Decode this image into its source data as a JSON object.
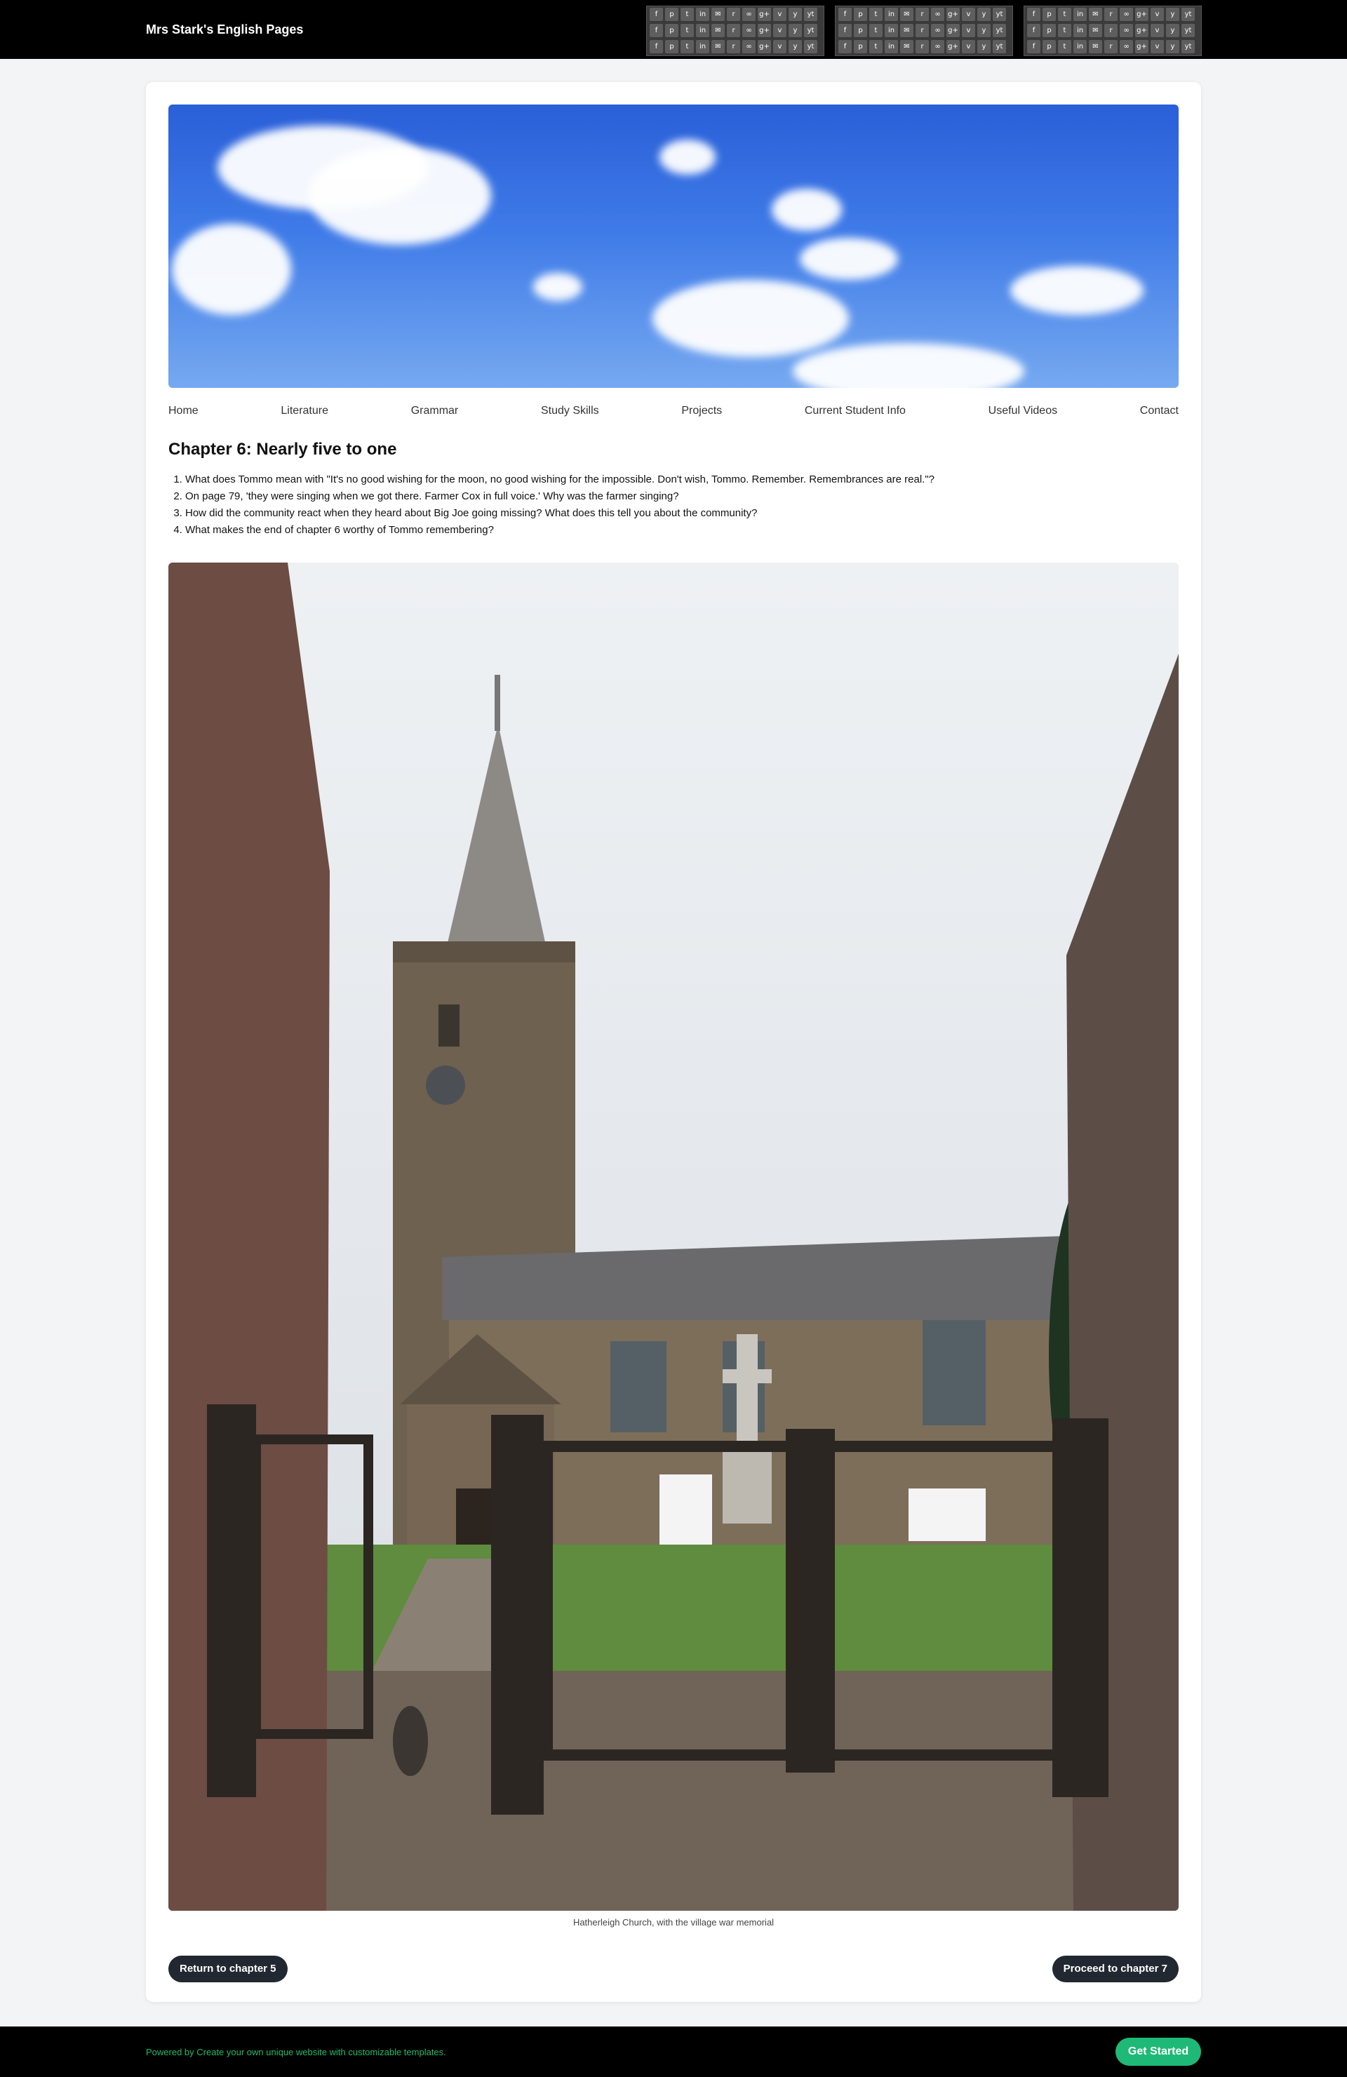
{
  "header": {
    "site_title": "Mrs Stark's English Pages",
    "social_icons": [
      "f",
      "p",
      "t",
      "in",
      "✉",
      "rss",
      "∞",
      "g+",
      "v",
      "y",
      "yt"
    ]
  },
  "nav": {
    "items": [
      "Home",
      "Literature",
      "Grammar",
      "Study Skills",
      "Projects",
      "Current Student Info",
      "Useful Videos",
      "Contact"
    ]
  },
  "main": {
    "title": "Chapter 6: Nearly five to one",
    "questions": [
      "What does Tommo mean with \"It's no good wishing for the moon, no good wishing for the impossible. Don't wish, Tommo. Remember. Remembrances are real.\"?",
      "On page 79, 'they were singing when we got there. Farmer Cox in full voice.' Why was the farmer singing?",
      "How did the community react when they heard about Big Joe going missing? What does this tell you about the community?",
      "What makes the end of chapter 6 worthy of Tommo remembering?"
    ],
    "photo_caption": "Hatherleigh Church, with the village war memorial",
    "prev_button": "Return to chapter 5",
    "next_button": "Proceed to chapter 7"
  },
  "footer": {
    "powered_text": "Powered by Create your own unique website with customizable templates.",
    "cta": "Get Started"
  }
}
